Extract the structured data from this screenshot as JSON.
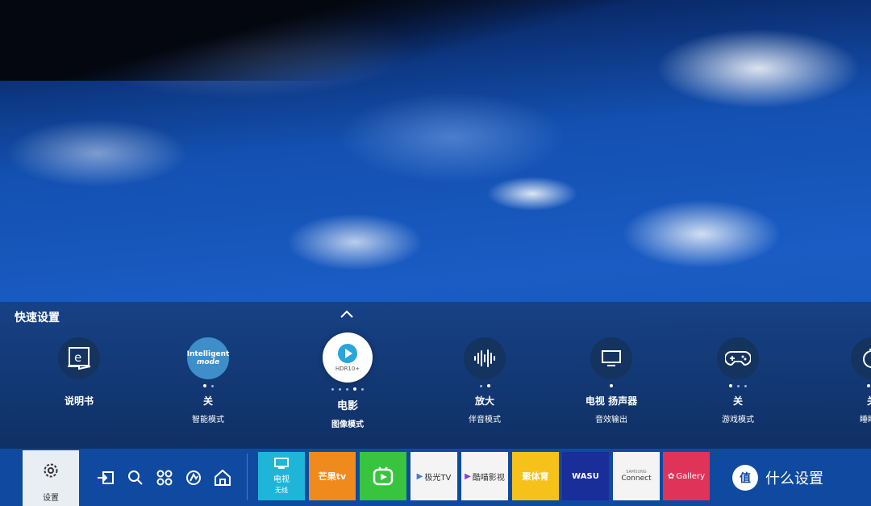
{
  "quick_settings": {
    "title": "快速设置",
    "items": [
      {
        "label": "说明书",
        "sub": "",
        "icon": "e-manual-icon"
      },
      {
        "icon_text_1": "Intelligent",
        "icon_text_2": "mode",
        "label": "关",
        "sub": "智能模式",
        "icon": "intelligent-mode-icon"
      },
      {
        "icon_text": "HDR10+",
        "label": "电影",
        "sub": "图像模式",
        "icon": "play-icon"
      },
      {
        "label": "放大",
        "sub": "伴音模式",
        "icon": "sound-wave-icon"
      },
      {
        "label": "电视 扬声器",
        "sub": "音效输出",
        "icon": "tv-speaker-icon"
      },
      {
        "label": "关",
        "sub": "游戏模式",
        "icon": "gamepad-icon"
      },
      {
        "label": "关",
        "sub": "睡眠定",
        "icon": "timer-icon"
      }
    ]
  },
  "taskbar": {
    "settings_label": "设置",
    "nav_icons": [
      "source-icon",
      "search-icon",
      "apps-icon",
      "ambient-icon",
      "home-icon"
    ],
    "apps": [
      {
        "name": "电视",
        "sub": "无线",
        "bg": "#1fb5d8"
      },
      {
        "name": "芒果tv",
        "bg": "#f08a1c",
        "color": "#ffffff"
      },
      {
        "name": "iQIYI",
        "bg": "#38c43f",
        "color": "#ffffff"
      },
      {
        "name": "极光TV",
        "bg": "#f4f4f4",
        "color": "#333333"
      },
      {
        "name": "酷喵影视",
        "bg": "#f4f4f4",
        "color": "#333333"
      },
      {
        "name": "聚体育",
        "bg": "#f6c21a",
        "color": "#ffffff"
      },
      {
        "name": "WASU",
        "bg": "#1a2e9a",
        "color": "#ffffff"
      },
      {
        "name_small": "SAMSUNG",
        "name": "Connect",
        "bg": "#f4f4f4",
        "color": "#333333"
      },
      {
        "name": "Gallery",
        "bg": "#e0335a",
        "color": "#ffffff"
      }
    ],
    "more_label": "什么设置"
  }
}
